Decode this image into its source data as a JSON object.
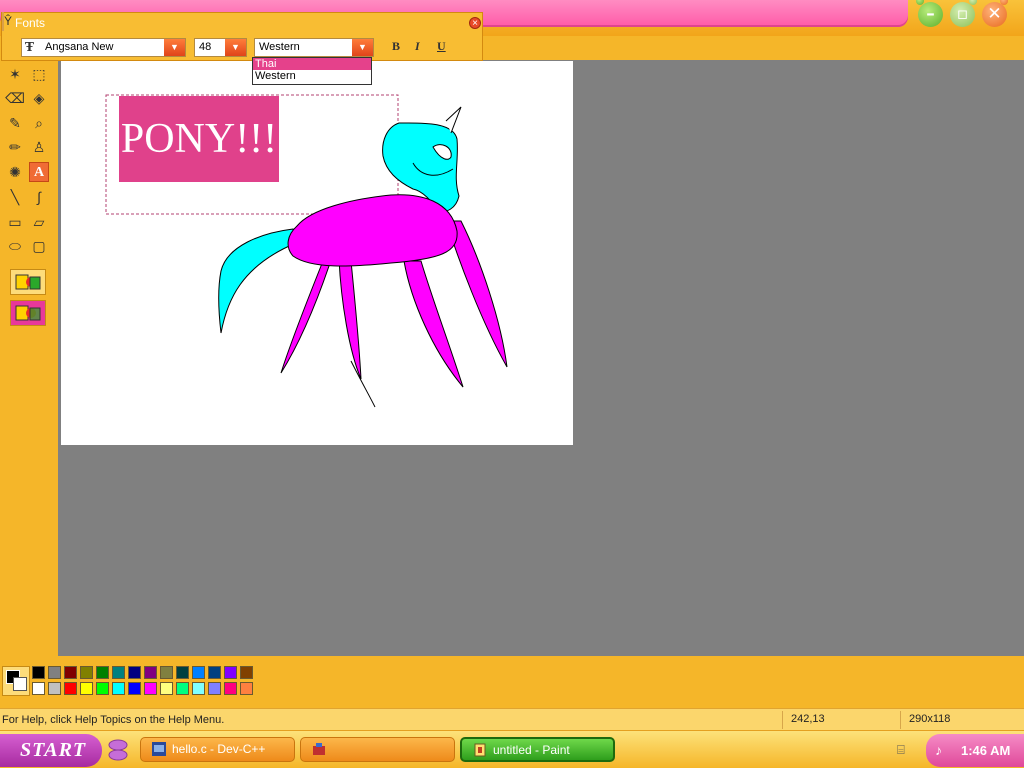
{
  "fonts_toolbar": {
    "title": "Fonts",
    "font_name": "Angsana New",
    "font_size": "48",
    "script": "Western",
    "script_options": [
      "Thai",
      "Western"
    ],
    "script_highlighted": "Thai",
    "bold_label": "B",
    "italic_label": "I",
    "underline_label": "U"
  },
  "canvas": {
    "text_box": "PONY!!!",
    "colors": {
      "text_bg": "#e0418b",
      "pony_body": "#ff00ff",
      "pony_head": "#00ffff"
    }
  },
  "status": {
    "help": "For Help, click Help Topics on the Help Menu.",
    "position": "242,13",
    "size": "290x118"
  },
  "taskbar": {
    "start_label": "START",
    "tasks": [
      {
        "label": "hello.c - Dev-C++"
      },
      {
        "label": ""
      },
      {
        "label": "untitled - Paint"
      }
    ],
    "clock": "1:46 AM"
  },
  "palette": [
    "#000000",
    "#808080",
    "#800000",
    "#808000",
    "#008000",
    "#008080",
    "#000080",
    "#800080",
    "#808040",
    "#004040",
    "#0080ff",
    "#004080",
    "#8000ff",
    "#804000",
    "#ffffff",
    "#c0c0c0",
    "#ff0000",
    "#ffff00",
    "#00ff00",
    "#00ffff",
    "#0000ff",
    "#ff00ff",
    "#ffff80",
    "#00ff80",
    "#80ffff",
    "#8080ff",
    "#ff0080",
    "#ff8040"
  ],
  "tools": [
    "free-select-icon",
    "rect-select-icon",
    "eraser-icon",
    "fill-icon",
    "color-picker-icon",
    "magnifier-icon",
    "pencil-icon",
    "brush-icon",
    "airbrush-icon",
    "text-icon",
    "line-icon",
    "curve-icon",
    "rectangle-icon",
    "polygon-icon",
    "ellipse-icon",
    "rounded-rect-icon"
  ]
}
